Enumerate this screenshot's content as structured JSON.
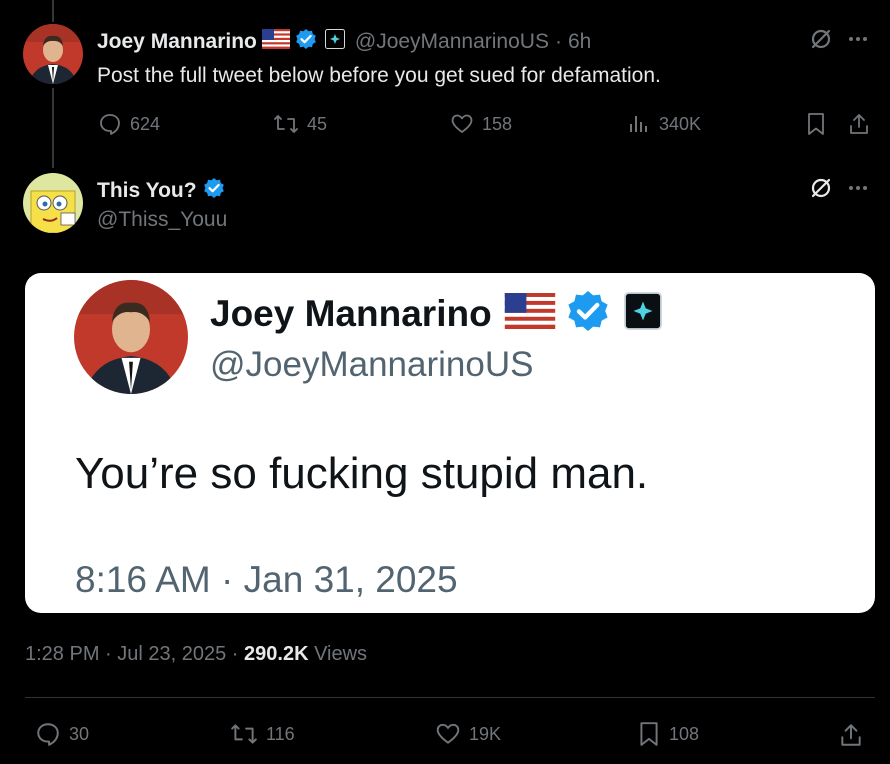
{
  "parent_tweet": {
    "display_name": "Joey Mannarino",
    "handle": "@JoeyMannarinoUS",
    "time": "6h",
    "text": "Post the full tweet below before you get sued for defamation.",
    "replies": "624",
    "reposts": "45",
    "likes": "158",
    "views": "340K"
  },
  "main_tweet": {
    "display_name": "This You?",
    "handle": "@Thiss_Youu",
    "quoted_image": {
      "display_name": "Joey Mannarino",
      "handle": "@JoeyMannarinoUS",
      "text": "You’re so fucking stupid man.",
      "timestamp": "8:16 AM · Jan 31, 2025"
    },
    "timestamp": "1:28 PM · Jul 23, 2025 · ",
    "views_count": "290.2K",
    "views_label": " Views",
    "replies": "30",
    "reposts": "116",
    "likes": "19K",
    "bookmarks": "108"
  },
  "icons": [
    "verified-badge-icon",
    "us-flag-icon",
    "affiliate-badge-icon",
    "grok-icon",
    "more-icon",
    "reply-icon",
    "repost-icon",
    "like-icon",
    "views-icon",
    "bookmark-icon",
    "share-icon"
  ],
  "colors": {
    "background": "#000000",
    "text": "#e7e9ea",
    "muted": "#71767b",
    "verified": "#1d9bf0"
  }
}
